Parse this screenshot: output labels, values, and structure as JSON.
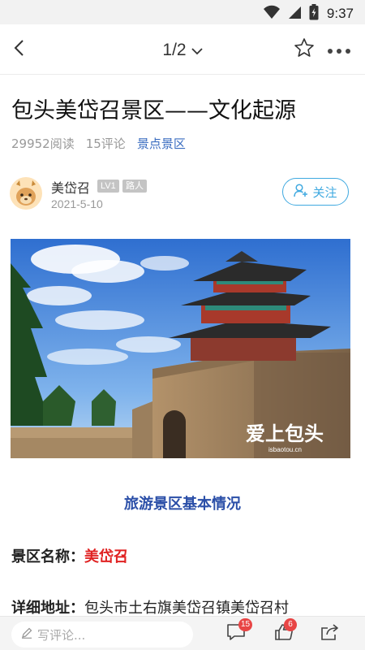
{
  "status_bar": {
    "time": "9:37",
    "icons": [
      "wifi-icon",
      "cellular-icon",
      "battery-icon"
    ]
  },
  "nav": {
    "pager": "1/2",
    "icons": [
      "back-arrow-icon",
      "chevron-down-icon",
      "star-icon",
      "more-icon"
    ]
  },
  "article": {
    "title": "包头美岱召景区——文化起源",
    "reads": "29952阅读",
    "comments": "15评论",
    "category": "景点景区"
  },
  "author": {
    "name": "美岱召",
    "level": "LV1",
    "role": "路人",
    "date": "2021-5-10",
    "follow_label": "关注"
  },
  "hero_image": {
    "watermark_text": "爱上包头",
    "watermark_url": "isbaotou.cn"
  },
  "content": {
    "section_heading": "旅游景区基本情况",
    "name_label": "景区名称：",
    "name_value": "美岱召",
    "address_label": "详细地址：",
    "address_value": "包头市土右旗美岱召镇美岱召村"
  },
  "bottom_bar": {
    "comment_placeholder": "写评论...",
    "comment_count": "15",
    "like_count": "6"
  },
  "colors": {
    "accent_blue": "#3fa9e0",
    "heading_blue": "#2b4fa8",
    "category_blue": "#3a6cc0",
    "highlight_red": "#e02222",
    "badge_red": "#e84545"
  }
}
